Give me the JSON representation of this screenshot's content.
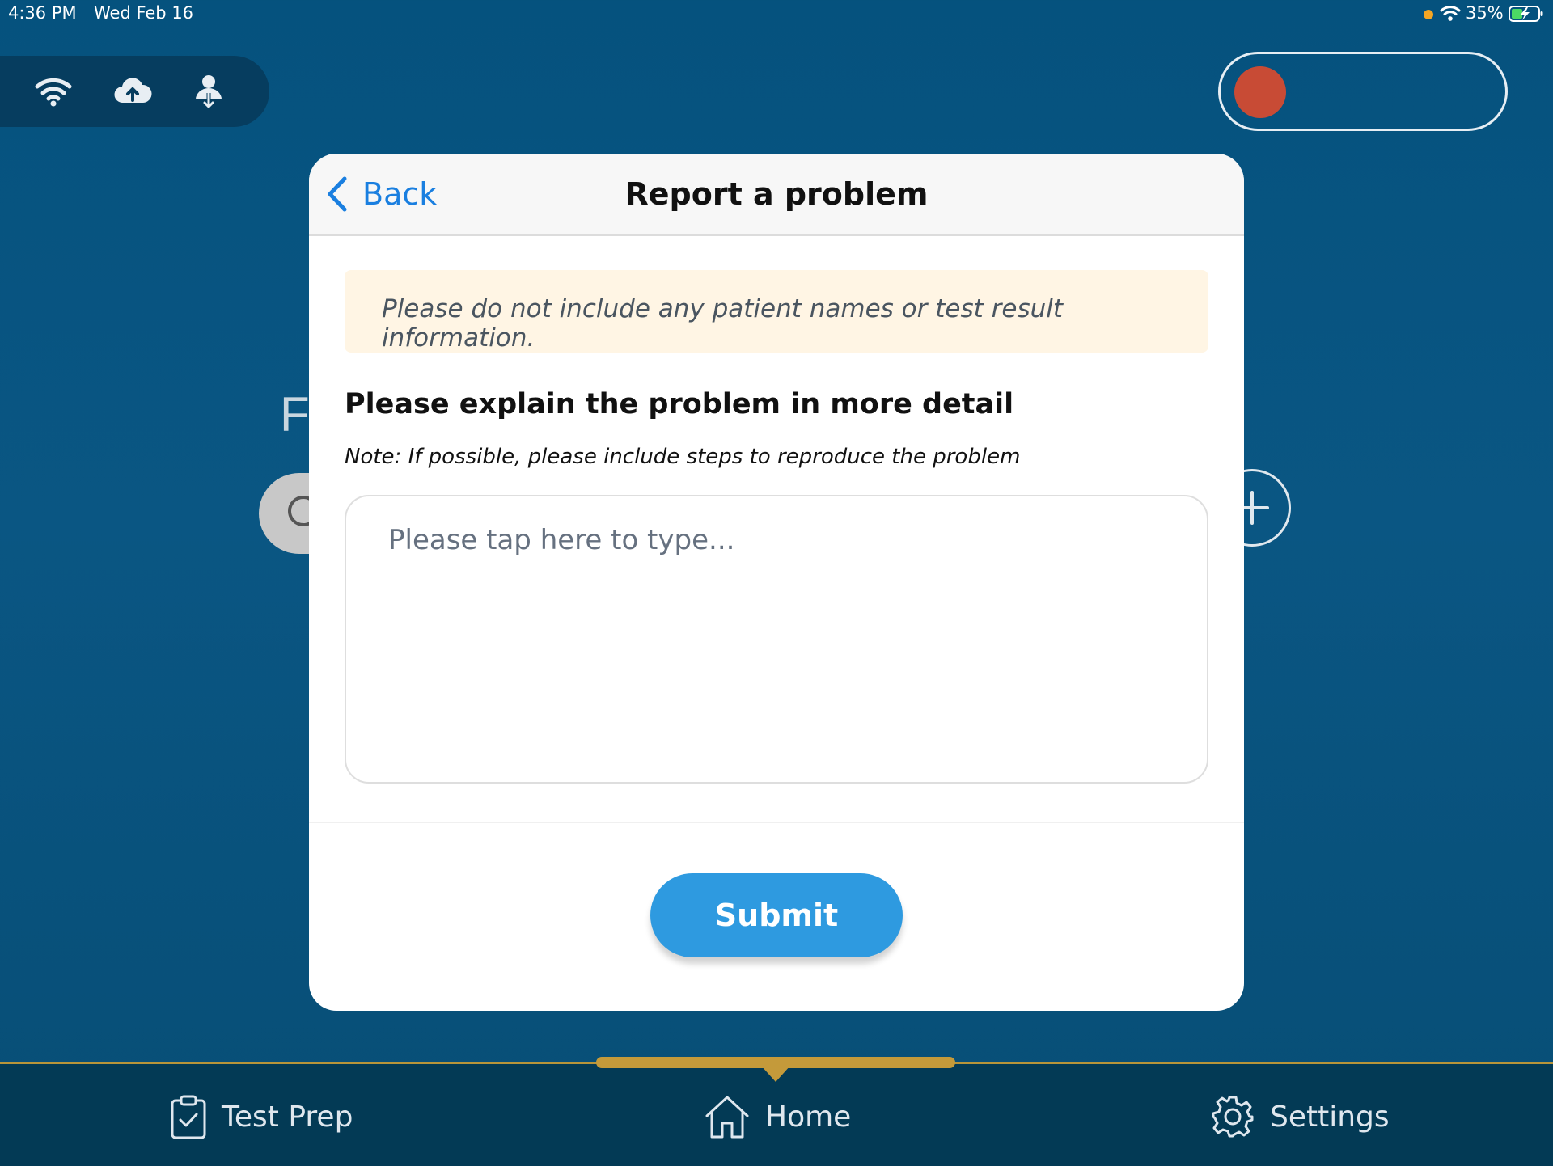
{
  "status_bar": {
    "time": "4:36 PM",
    "date": "Wed Feb 16",
    "battery_percent": "35%",
    "icons": [
      "wifi-icon",
      "battery-charging-icon"
    ],
    "recording_dot_color": "#f5a623"
  },
  "top_toolbar": {
    "icons": [
      "wifi-icon",
      "cloud-upload-icon",
      "user-sync-icon"
    ]
  },
  "record_toggle": {
    "state": "off",
    "knob_color": "#c84b35"
  },
  "background": {
    "partial_letter": "F",
    "plus_icon": "plus-icon"
  },
  "modal": {
    "back_label": "Back",
    "title": "Report a problem",
    "warning": "Please do not include any patient names or test result information.",
    "heading": "Please explain the problem in more detail",
    "note": "Note: If possible, please include steps to reproduce the problem",
    "textarea_placeholder": "Please tap here to type...",
    "textarea_value": "",
    "submit_label": "Submit"
  },
  "tab_bar": {
    "active_tab": "Home",
    "tabs": [
      {
        "label": "Test Prep",
        "icon": "clipboard-check-icon"
      },
      {
        "label": "Home",
        "icon": "home-icon"
      },
      {
        "label": "Settings",
        "icon": "gear-icon"
      }
    ]
  },
  "colors": {
    "background": "#05527e",
    "accent_blue": "#2e9ae0",
    "link_blue": "#1a7fe0",
    "warning_bg": "#fff5e4",
    "tab_indicator": "#c49a3a"
  }
}
